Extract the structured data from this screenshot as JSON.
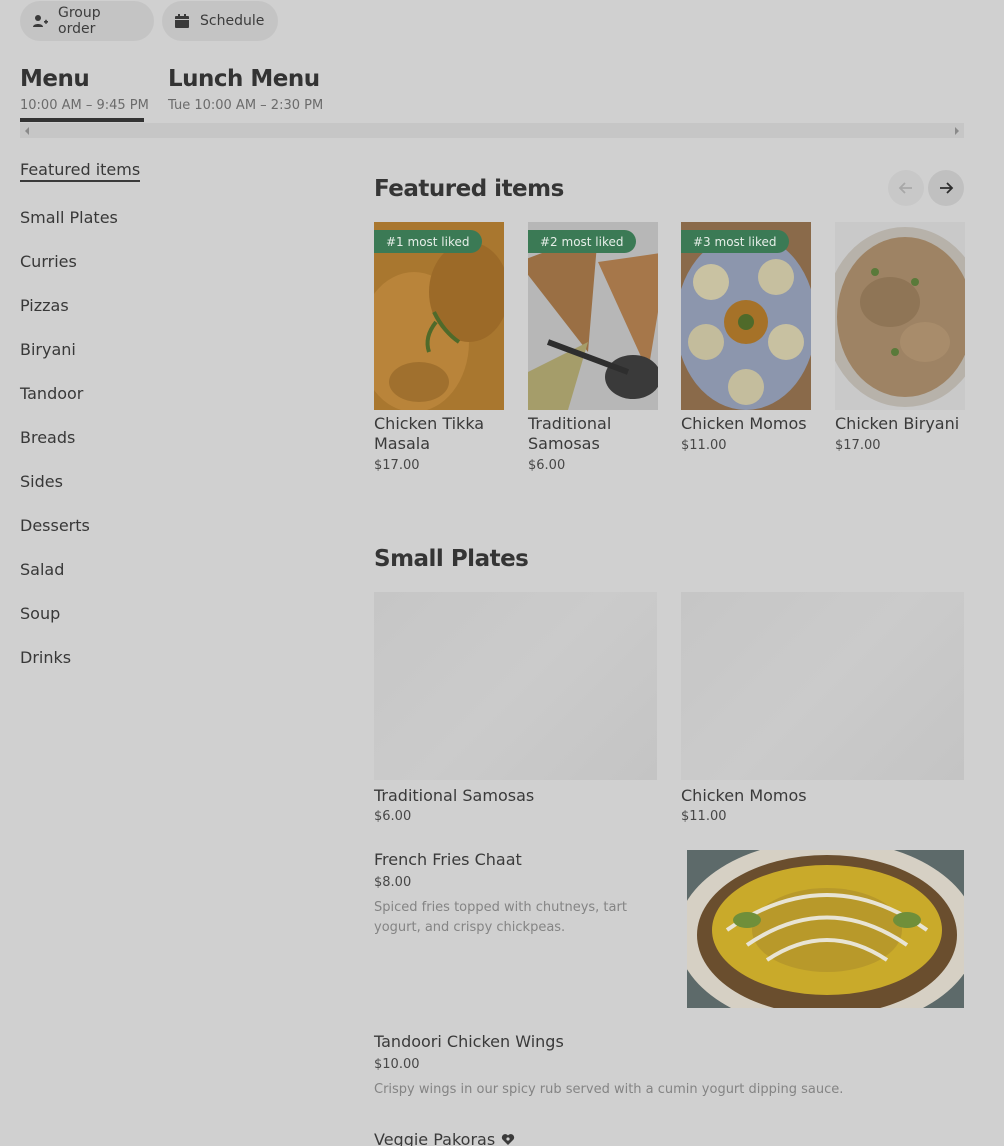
{
  "top_actions": {
    "group_order": "Group order",
    "schedule": "Schedule"
  },
  "menus": [
    {
      "title": "Menu",
      "hours": "10:00 AM – 9:45 PM"
    },
    {
      "title": "Lunch Menu",
      "hours": "Tue 10:00 AM – 2:30 PM"
    }
  ],
  "sidebar": {
    "items": [
      {
        "label": "Featured items"
      },
      {
        "label": "Small Plates"
      },
      {
        "label": "Curries"
      },
      {
        "label": "Pizzas"
      },
      {
        "label": "Biryani"
      },
      {
        "label": "Tandoor"
      },
      {
        "label": "Breads"
      },
      {
        "label": "Sides"
      },
      {
        "label": "Desserts"
      },
      {
        "label": "Salad"
      },
      {
        "label": "Soup"
      },
      {
        "label": "Drinks"
      }
    ]
  },
  "featured": {
    "title": "Featured items",
    "items": [
      {
        "badge": "#1 most liked",
        "name": "Chicken Tikka Masala",
        "price": "$17.00"
      },
      {
        "badge": "#2 most liked",
        "name": "Traditional Samosas",
        "price": "$6.00"
      },
      {
        "badge": "#3 most liked",
        "name": "Chicken Momos",
        "price": "$11.00"
      },
      {
        "badge": "",
        "name": "Chicken Biryani",
        "price": "$17.00"
      }
    ]
  },
  "small_plates": {
    "title": "Small Plates",
    "grid": [
      {
        "name": "Traditional Samosas",
        "price": "$6.00"
      },
      {
        "name": "Chicken Momos",
        "price": "$11.00"
      }
    ],
    "list": [
      {
        "name": "French Fries Chaat",
        "price": "$8.00",
        "description": "Spiced fries topped with chutneys, tart yogurt, and crispy chickpeas."
      },
      {
        "name": "Tandoori Chicken Wings",
        "price": "$10.00",
        "description": "Crispy wings in our spicy rub served with a cumin yogurt dipping sauce."
      },
      {
        "name": "Veggie Pakoras",
        "price": "",
        "description": ""
      }
    ]
  },
  "colors": {
    "badge_green": "#3b7a55",
    "overlay_bg": "#d0d0d0"
  }
}
